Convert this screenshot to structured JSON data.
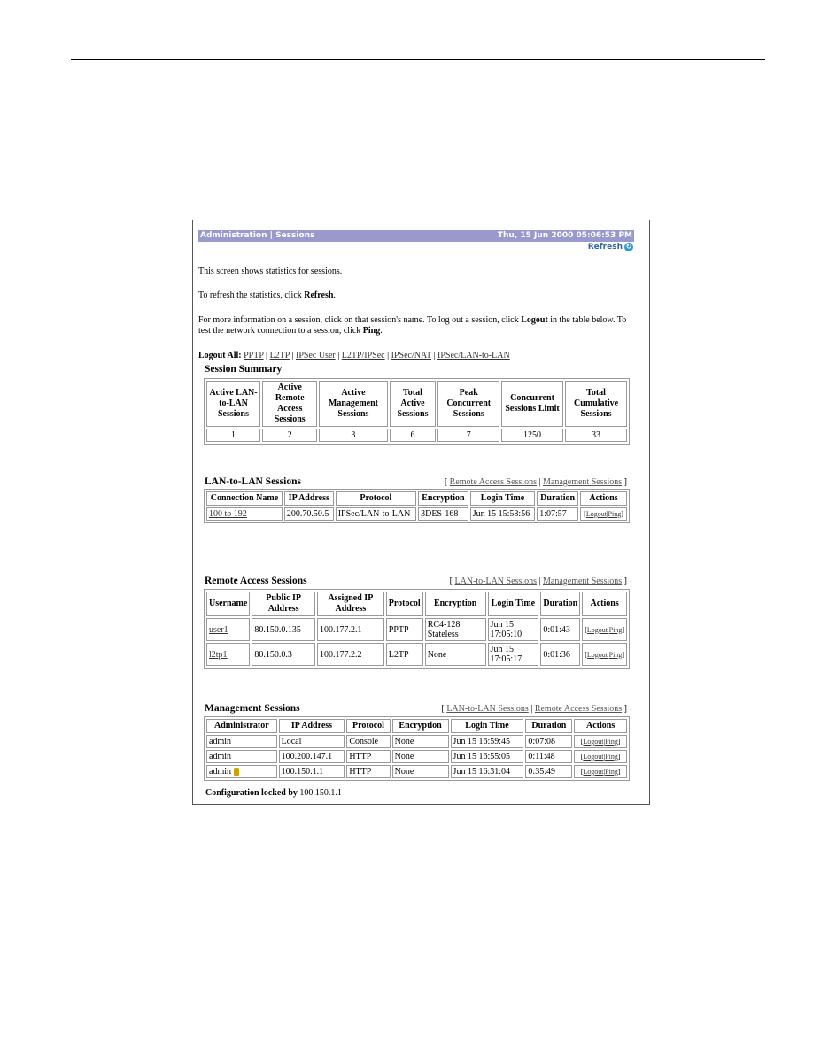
{
  "header": {
    "breadcrumb": "Administration | Sessions",
    "datetime": "Thu, 15 Jun 2000 05:06:53 PM",
    "refresh_label": "Refresh",
    "refresh_icon": "refresh-icon"
  },
  "intro": {
    "line1": "This screen shows statistics for sessions.",
    "line2_pre": "To refresh the statistics, click ",
    "line2_bold": "Refresh",
    "line2_post": ".",
    "line3_pre": "For more information on a session, click on that session's name. To log out a session, click ",
    "line3_bold1": "Logout",
    "line3_mid": " in the table below. To test the network connection to a session, click ",
    "line3_bold2": "Ping",
    "line3_post": "."
  },
  "logout_all": {
    "label": "Logout All:",
    "links": [
      "PPTP",
      "L2TP",
      "IPSec User",
      "L2TP/IPSec",
      "IPSec/NAT",
      "IPSec/LAN-to-LAN"
    ]
  },
  "summary": {
    "title": "Session Summary",
    "headers": [
      "Active LAN-to-LAN Sessions",
      "Active Remote Access Sessions",
      "Active Management Sessions",
      "Total Active Sessions",
      "Peak Concurrent Sessions",
      "Concurrent Sessions Limit",
      "Total Cumulative Sessions"
    ],
    "values": [
      "1",
      "2",
      "3",
      "6",
      "7",
      "1250",
      "33"
    ]
  },
  "lan": {
    "title": "LAN-to-LAN Sessions",
    "links": [
      "Remote Access Sessions",
      "Management Sessions"
    ],
    "headers": [
      "Connection Name",
      "IP Address",
      "Protocol",
      "Encryption",
      "Login Time",
      "Duration",
      "Actions"
    ],
    "rows": [
      {
        "name": "100 to 192",
        "ip": "200.70.50.5",
        "protocol": "IPSec/LAN-to-LAN",
        "encryption": "3DES-168",
        "login": "Jun 15 15:58:56",
        "duration": "1:07:57"
      }
    ]
  },
  "remote": {
    "title": "Remote Access Sessions",
    "links": [
      "LAN-to-LAN Sessions",
      "Management Sessions"
    ],
    "headers": [
      "Username",
      "Public IP Address",
      "Assigned IP Address",
      "Protocol",
      "Encryption",
      "Login Time",
      "Duration",
      "Actions"
    ],
    "rows": [
      {
        "user": "user1",
        "public_ip": "80.150.0.135",
        "assigned_ip": "100.177.2.1",
        "protocol": "PPTP",
        "encryption": "RC4-128 Stateless",
        "login": "Jun 15 17:05:10",
        "duration": "0:01:43"
      },
      {
        "user": "l2tp1",
        "public_ip": "80.150.0.3",
        "assigned_ip": "100.177.2.2",
        "protocol": "L2TP",
        "encryption": "None",
        "login": "Jun 15 17:05:17",
        "duration": "0:01:36"
      }
    ]
  },
  "mgmt": {
    "title": "Management Sessions",
    "links": [
      "LAN-to-LAN Sessions",
      "Remote Access Sessions"
    ],
    "headers": [
      "Administrator",
      "IP Address",
      "Protocol",
      "Encryption",
      "Login Time",
      "Duration",
      "Actions"
    ],
    "rows": [
      {
        "admin": "admin",
        "ip": "Local",
        "protocol": "Console",
        "encryption": "None",
        "login": "Jun 15 16:59:45",
        "duration": "0:07:08"
      },
      {
        "admin": "admin",
        "ip": "100.200.147.1",
        "protocol": "HTTP",
        "encryption": "None",
        "login": "Jun 15 16:55:05",
        "duration": "0:11:48"
      },
      {
        "admin": "admin",
        "ip": "100.150.1.1",
        "protocol": "HTTP",
        "encryption": "None",
        "login": "Jun 15 16:31:04",
        "duration": "0:35:49"
      }
    ],
    "lock_row": 2
  },
  "actions": {
    "logout": "Logout",
    "ping": "Ping",
    "open": "[",
    "sep": "|",
    "close": "]"
  },
  "footer": {
    "locked_label": "Configuration locked by",
    "locked_value": "100.150.1.1"
  }
}
